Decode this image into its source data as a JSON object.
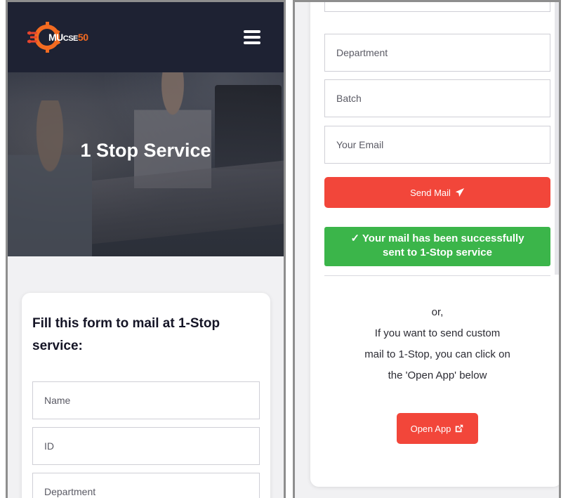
{
  "left": {
    "brand": {
      "prefix": "MU",
      "mid": "CSE",
      "num": "50"
    },
    "hero_title": "1 Stop Service",
    "form_title": "Fill this form to mail at 1-Stop service:",
    "fields": {
      "name": "Name",
      "id": "ID",
      "department": "Department"
    }
  },
  "right": {
    "fields": {
      "department": "Department",
      "batch": "Batch",
      "email": "Your Email"
    },
    "send_button": "Send Mail",
    "success_line1": "✓ Your mail has been successfully",
    "success_line2": "sent to 1-Stop service",
    "info": {
      "or": "or,",
      "line1": "If you want to send custom",
      "line2": "mail to 1-Stop, you can click on",
      "line3": "the 'Open App' below"
    },
    "open_button": "Open App"
  },
  "colors": {
    "navbar": "#1e2233",
    "accent_red": "#f2463a",
    "success_green": "#3bb54a",
    "brand_orange": "#f36b21"
  },
  "icons": {
    "menu": "hamburger-icon",
    "send": "paper-plane-icon",
    "external": "external-link-icon",
    "logo": "gear-chip-logo"
  }
}
